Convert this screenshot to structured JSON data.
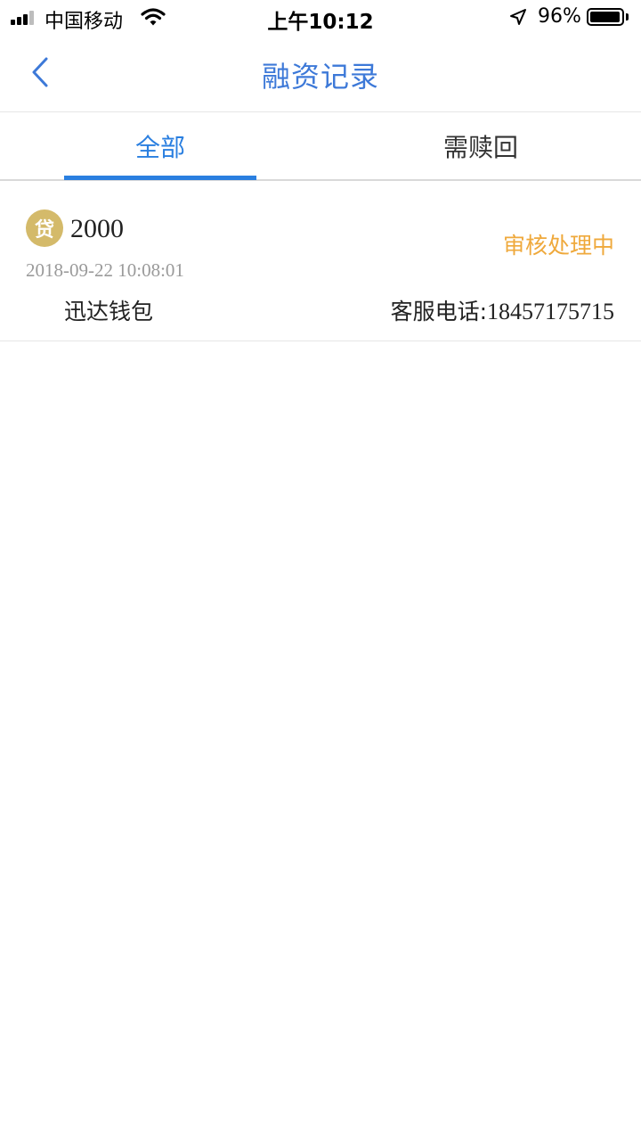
{
  "status_bar": {
    "carrier": "中国移动",
    "time": "上午10:12",
    "battery_percent_text": "96%",
    "battery_level": 0.96,
    "signal_bars_filled": 3,
    "signal_bars_total": 4,
    "icons": [
      "signal-icon",
      "wifi-icon",
      "location-arrow-icon",
      "battery-icon"
    ]
  },
  "nav": {
    "back_icon": "chevron-left-icon",
    "title": "融资记录",
    "title_color": "#3d79d8"
  },
  "tabs": {
    "items": [
      {
        "label": "全部",
        "active": true
      },
      {
        "label": "需赎回",
        "active": false
      }
    ],
    "active_color": "#2a7fe0"
  },
  "records": [
    {
      "badge": "贷",
      "amount": "2000",
      "status": "审核处理中",
      "time": "2018-09-22 10:08:01",
      "provider": "迅达钱包",
      "phone_label": "客服电话:",
      "phone_number": "18457175715"
    }
  ],
  "colors": {
    "badge_gold": "#d4ba6a",
    "status_orange": "#efa93c"
  }
}
